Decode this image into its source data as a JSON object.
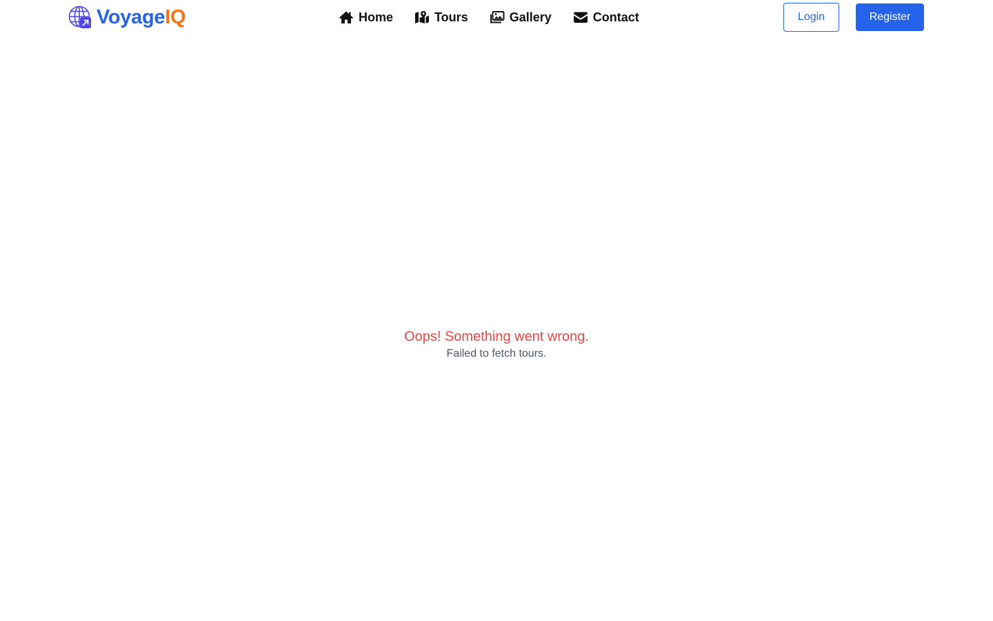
{
  "brand": {
    "name_part1": "Voyage",
    "name_part2": "IQ",
    "logo_icon": "globe-plane-icon",
    "colors": {
      "primary": "#2563eb",
      "accent": "#f97316",
      "logo": "#4f46e5"
    }
  },
  "nav": {
    "items": [
      {
        "label": "Home",
        "icon": "home-icon"
      },
      {
        "label": "Tours",
        "icon": "map-icon"
      },
      {
        "label": "Gallery",
        "icon": "images-icon"
      },
      {
        "label": "Contact",
        "icon": "envelope-icon"
      }
    ]
  },
  "auth": {
    "login_label": "Login",
    "register_label": "Register"
  },
  "error": {
    "title": "Oops! Something went wrong.",
    "message": "Failed to fetch tours.",
    "title_color": "#ef4444",
    "message_color": "#4b5563"
  }
}
